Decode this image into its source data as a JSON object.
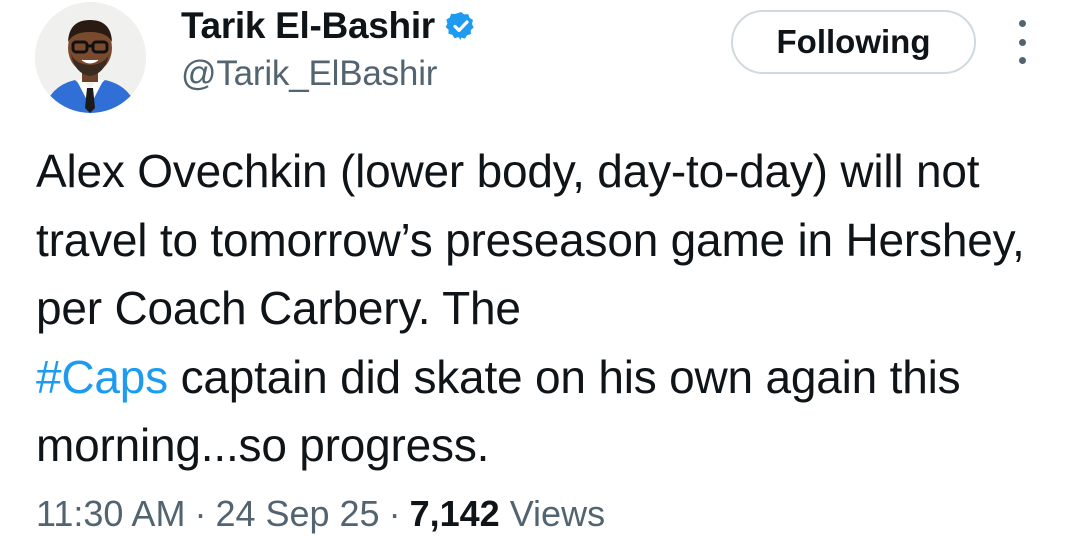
{
  "author": {
    "display_name": "Tarik El-Bashir",
    "handle": "@Tarik_ElBashir",
    "verified": true,
    "avatar": "profile-photo"
  },
  "follow_button_label": "Following",
  "more_icon": "more-options-vertical-dots",
  "tweet": {
    "text_before_hashtag": "Alex Ovechkin (lower body, day-to-day) will not travel to tomorrow’s preseason game in Hershey, per Coach Carbery. The",
    "hashtag": "#Caps",
    "text_after_hashtag": "captain did skate on his own again this morning...so progress."
  },
  "meta": {
    "time": "11:30 AM",
    "separator": "·",
    "date": "24 Sep 25",
    "views_count": "7,142",
    "views_label": "Views"
  },
  "colors": {
    "accent": "#1d9bf0",
    "text_primary": "#0f1419",
    "text_secondary": "#536471",
    "button_border": "#cfd9de"
  }
}
